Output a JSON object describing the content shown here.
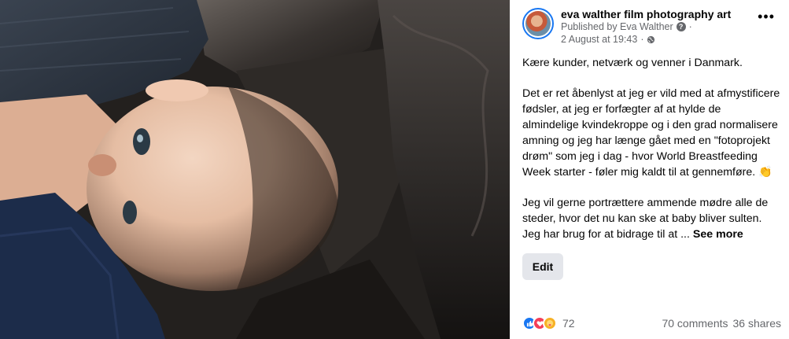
{
  "post": {
    "page_name": "eva walther film photography art",
    "published_by": "Published by Eva Walther",
    "date": "2 August at 19:43",
    "paragraphs": [
      "Kære kunder, netværk og venner i Danmark.",
      "Det er ret åbenlyst at jeg er vild med at afmystificere fødsler, at jeg er forfægter af at hylde de almindelige kvindekroppe og i den grad normalisere amning og jeg har længe gået med en \"fotoprojekt drøm\" som jeg i dag - hvor World Breastfeeding Week starter - føler mig kaldt til at gennemføre.",
      "Jeg vil gerne portrættere ammende mødre alle de steder, hvor det nu kan ske at baby bliver sulten. Jeg har brug for at bidrage til at ..."
    ],
    "emoji": "👏",
    "see_more": "See more",
    "edit_label": "Edit"
  },
  "engagement": {
    "reaction_icons": [
      "like-icon",
      "love-icon",
      "care-icon"
    ],
    "reaction_count": "72",
    "comments": "70 comments",
    "shares": "36 shares"
  },
  "colors": {
    "accent": "#1877f2",
    "like": "#1877f2",
    "love": "#f33e58",
    "care": "#f7b125",
    "edit_bg": "#e4e6eb",
    "secondary_text": "#65676b"
  }
}
